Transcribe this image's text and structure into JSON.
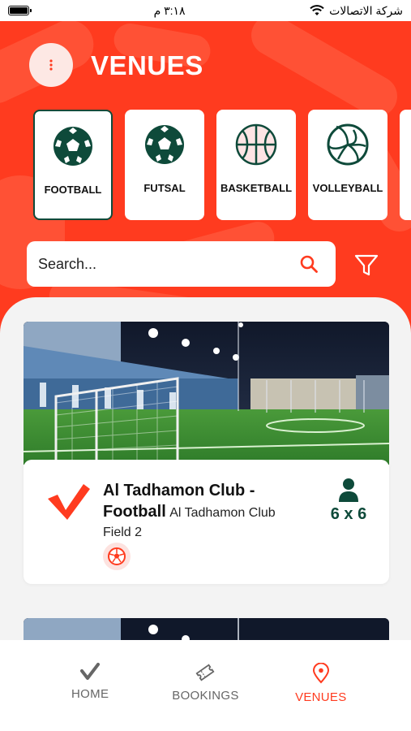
{
  "status_bar": {
    "time": "٣:١٨ م",
    "carrier": "شركة الاتصالات",
    "battery_level": 1.0
  },
  "header": {
    "title": "VENUES",
    "accent_color": "#ff3b1f"
  },
  "categories": [
    {
      "label": "FOOTBALL",
      "icon": "football-icon",
      "selected": true
    },
    {
      "label": "FUTSAL",
      "icon": "football-icon",
      "selected": false
    },
    {
      "label": "BASKETBALL",
      "icon": "basketball-icon",
      "selected": false
    },
    {
      "label": "VOLLEYBALL",
      "icon": "volleyball-icon",
      "selected": false
    }
  ],
  "search": {
    "placeholder": "Search...",
    "value": ""
  },
  "venues": [
    {
      "title": "Al Tadhamon Club - Football",
      "subtitle": "Al Tadhamon Club Field 2",
      "capacity": "6 x 6",
      "sport_icon": "football-icon"
    }
  ],
  "nav": {
    "items": [
      {
        "label": "HOME",
        "icon": "check-icon",
        "active": false
      },
      {
        "label": "BOOKINGS",
        "icon": "ticket-icon",
        "active": false
      },
      {
        "label": "VENUES",
        "icon": "location-pin-icon",
        "active": true
      }
    ]
  },
  "colors": {
    "brand_red": "#ff3b1f",
    "dark_green": "#0e4a3a"
  }
}
